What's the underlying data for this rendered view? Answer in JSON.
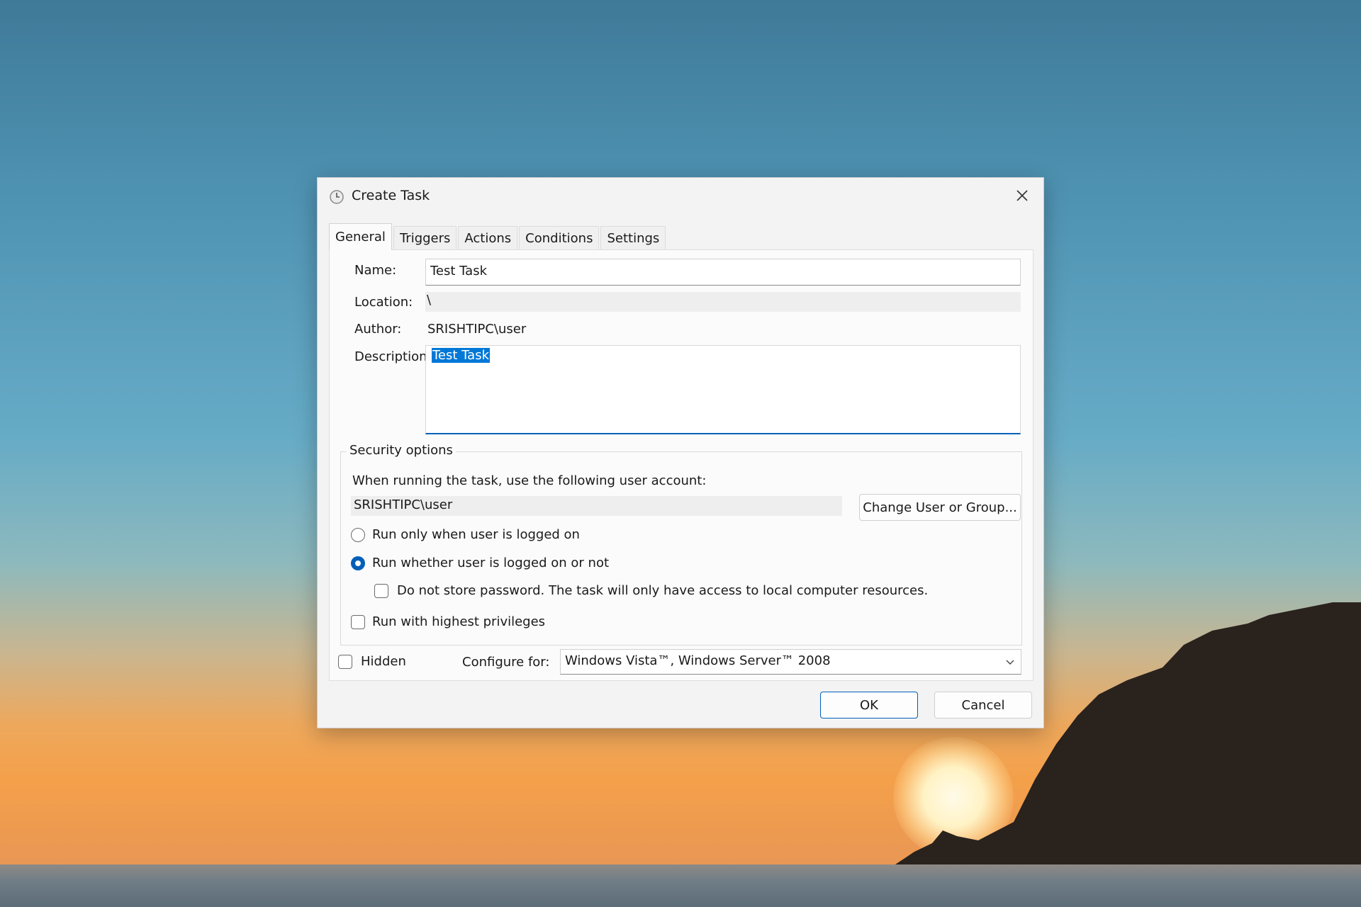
{
  "window": {
    "title": "Create Task",
    "icon": "clock-icon",
    "close_icon": "close-icon"
  },
  "tabs": [
    {
      "label": "General",
      "active": true
    },
    {
      "label": "Triggers"
    },
    {
      "label": "Actions"
    },
    {
      "label": "Conditions"
    },
    {
      "label": "Settings"
    }
  ],
  "general": {
    "name_label": "Name:",
    "name_value": "Test Task",
    "location_label": "Location:",
    "location_value": "\\",
    "author_label": "Author:",
    "author_value": "SRISHTIPC\\user",
    "description_label": "Description:",
    "description_value": "Test Task"
  },
  "security": {
    "title": "Security options",
    "account_prompt": "When running the task, use the following user account:",
    "account_value": "SRISHTIPC\\user",
    "change_button": "Change User or Group...",
    "radio_logged_on": "Run only when user is logged on",
    "radio_whether": "Run whether user is logged on or not",
    "selected_radio": "whether",
    "no_store_password": "Do not store password.  The task will only have access to local computer resources.",
    "highest_privileges": "Run with highest privileges"
  },
  "footer": {
    "hidden_label": "Hidden",
    "configure_label": "Configure for:",
    "configure_value": "Windows Vista™, Windows Server™ 2008",
    "ok": "OK",
    "cancel": "Cancel"
  },
  "colors": {
    "accent": "#005fb8",
    "selection": "#0078d7"
  }
}
